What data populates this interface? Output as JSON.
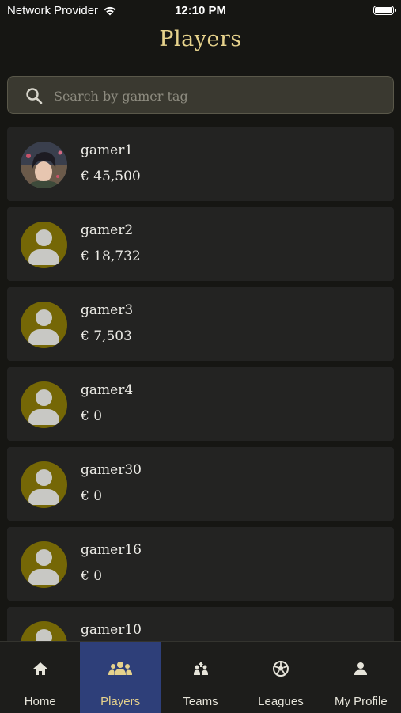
{
  "status_bar": {
    "carrier": "Network Provider",
    "time": "12:10 PM"
  },
  "header": {
    "title": "Players"
  },
  "search": {
    "placeholder": "Search by gamer tag",
    "value": ""
  },
  "players": [
    {
      "name": "gamer1",
      "balance": "€ 45,500",
      "avatar": "photo"
    },
    {
      "name": "gamer2",
      "balance": "€ 18,732",
      "avatar": "default"
    },
    {
      "name": "gamer3",
      "balance": "€ 7,503",
      "avatar": "default"
    },
    {
      "name": "gamer4",
      "balance": "€ 0",
      "avatar": "default"
    },
    {
      "name": "gamer30",
      "balance": "€ 0",
      "avatar": "default"
    },
    {
      "name": "gamer16",
      "balance": "€ 0",
      "avatar": "default"
    },
    {
      "name": "gamer10",
      "balance": "",
      "avatar": "default"
    }
  ],
  "tabs": [
    {
      "label": "Home",
      "icon": "home-icon",
      "active": false
    },
    {
      "label": "Players",
      "icon": "players-icon",
      "active": true
    },
    {
      "label": "Teams",
      "icon": "teams-icon",
      "active": false
    },
    {
      "label": "Leagues",
      "icon": "soccer-ball-icon",
      "active": false
    },
    {
      "label": "My Profile",
      "icon": "profile-icon",
      "active": false
    }
  ],
  "colors": {
    "background": "#161613",
    "accent_gold": "#e6d28c",
    "avatar_olive": "#756706",
    "active_tab": "#2e3f79",
    "card": "#232322"
  }
}
